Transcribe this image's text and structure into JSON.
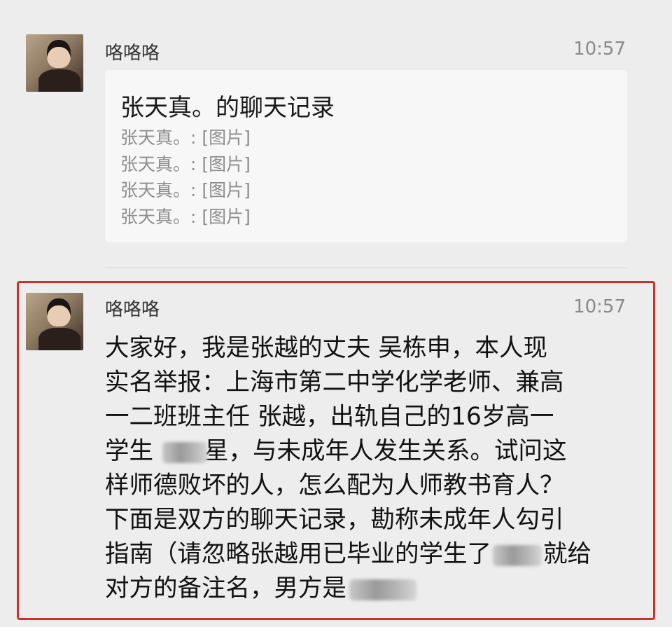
{
  "message1": {
    "sender": "咯咯咯",
    "time": "10:57",
    "record": {
      "title": "张天真。的聊天记录",
      "lines": [
        "张天真。: [图片]",
        "张天真。: [图片]",
        "张天真。: [图片]",
        "张天真。: [图片]"
      ]
    }
  },
  "message2": {
    "sender": "咯咯咯",
    "time": "10:57",
    "lines": [
      "大家好，我是张越的丈夫 吴栋申，本人现",
      "实名举报：上海市第二中学化学老师、兼高",
      "一二班班主任 张越，出轨自己的16岁高一",
      [
        "学生 ",
        "星，与未成年人发生关系。试问这"
      ],
      "样师德败坏的人，怎么配为人师教书育人？",
      "下面是双方的聊天记录，勘称未成年人勾引",
      [
        "指南（请忽略张越用已毕业的学生了",
        "就给"
      ],
      [
        "对方的备注名，男方是",
        ""
      ]
    ],
    "redaction_color": "#a8a8a8"
  },
  "colors": {
    "highlight_border": "#d0302c",
    "card_bg": "#f7f7f7",
    "muted_text": "#8d8d8d"
  },
  "icons": {
    "avatar": "user-avatar-photo"
  }
}
